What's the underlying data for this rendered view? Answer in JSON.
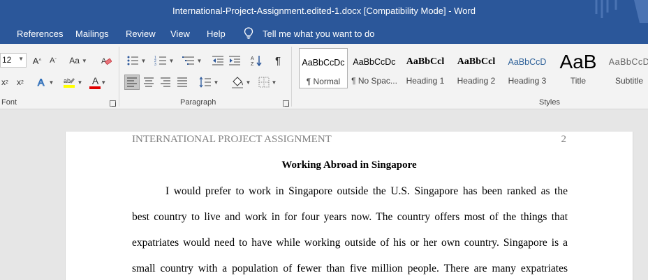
{
  "window": {
    "title": "International-Project-Assignment.edited-1.docx [Compatibility Mode]  -  Word"
  },
  "menu": {
    "tabs": [
      "References",
      "Mailings",
      "Review",
      "View",
      "Help"
    ],
    "tell_me": "Tell me what you want to do"
  },
  "ribbon": {
    "font": {
      "size_value": "12",
      "grow_label": "A",
      "shrink_label": "A",
      "case_label": "Aa",
      "subscript_label": "x",
      "superscript_label": "x",
      "font_color_label": "A",
      "highlight_color": "#ffff00",
      "font_color": "#e00000",
      "group_label": "Font"
    },
    "paragraph": {
      "group_label": "Paragraph",
      "pilcrow": "¶"
    },
    "styles": {
      "group_label": "Styles",
      "items": [
        {
          "preview": "AaBbCcDc",
          "label": "¶ Normal"
        },
        {
          "preview": "AaBbCcDc",
          "label": "¶ No Spac..."
        },
        {
          "preview": "AaBbCcl",
          "label": "Heading 1"
        },
        {
          "preview": "AaBbCcl",
          "label": "Heading 2"
        },
        {
          "preview": "AaBbCcD",
          "label": "Heading 3"
        },
        {
          "preview": "AaB",
          "label": "Title"
        },
        {
          "preview": "AaBbCcD",
          "label": "Subtitle"
        }
      ]
    }
  },
  "document": {
    "header_text": "INTERNATIONAL PROJECT ASSIGNMENT",
    "page_number": "2",
    "title": "Working Abroad in Singapore",
    "lines": [
      "I would prefer to work in Singapore outside the U.S. Singapore has been ranked as the",
      "best country to live and work in for four years now. The country offers most of the things that",
      "expatriates would need to have while working outside of his or her own country. Singapore is a",
      "small country with a population of fewer than five million people. There are many expatriates"
    ]
  },
  "colors": {
    "brand": "#2b579a",
    "ribbon": "#f3f3f3",
    "canvas": "#e6e6e6"
  }
}
